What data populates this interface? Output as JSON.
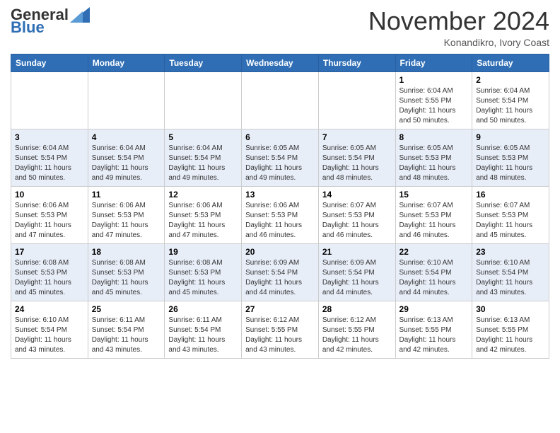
{
  "header": {
    "logo_general": "General",
    "logo_blue": "Blue",
    "month_title": "November 2024",
    "location": "Konandikro, Ivory Coast"
  },
  "weekdays": [
    "Sunday",
    "Monday",
    "Tuesday",
    "Wednesday",
    "Thursday",
    "Friday",
    "Saturday"
  ],
  "weeks": [
    [
      {
        "day": "",
        "sunrise": "",
        "sunset": "",
        "daylight": ""
      },
      {
        "day": "",
        "sunrise": "",
        "sunset": "",
        "daylight": ""
      },
      {
        "day": "",
        "sunrise": "",
        "sunset": "",
        "daylight": ""
      },
      {
        "day": "",
        "sunrise": "",
        "sunset": "",
        "daylight": ""
      },
      {
        "day": "",
        "sunrise": "",
        "sunset": "",
        "daylight": ""
      },
      {
        "day": "1",
        "sunrise": "Sunrise: 6:04 AM",
        "sunset": "Sunset: 5:55 PM",
        "daylight": "Daylight: 11 hours and 50 minutes."
      },
      {
        "day": "2",
        "sunrise": "Sunrise: 6:04 AM",
        "sunset": "Sunset: 5:54 PM",
        "daylight": "Daylight: 11 hours and 50 minutes."
      }
    ],
    [
      {
        "day": "3",
        "sunrise": "Sunrise: 6:04 AM",
        "sunset": "Sunset: 5:54 PM",
        "daylight": "Daylight: 11 hours and 50 minutes."
      },
      {
        "day": "4",
        "sunrise": "Sunrise: 6:04 AM",
        "sunset": "Sunset: 5:54 PM",
        "daylight": "Daylight: 11 hours and 49 minutes."
      },
      {
        "day": "5",
        "sunrise": "Sunrise: 6:04 AM",
        "sunset": "Sunset: 5:54 PM",
        "daylight": "Daylight: 11 hours and 49 minutes."
      },
      {
        "day": "6",
        "sunrise": "Sunrise: 6:05 AM",
        "sunset": "Sunset: 5:54 PM",
        "daylight": "Daylight: 11 hours and 49 minutes."
      },
      {
        "day": "7",
        "sunrise": "Sunrise: 6:05 AM",
        "sunset": "Sunset: 5:54 PM",
        "daylight": "Daylight: 11 hours and 48 minutes."
      },
      {
        "day": "8",
        "sunrise": "Sunrise: 6:05 AM",
        "sunset": "Sunset: 5:53 PM",
        "daylight": "Daylight: 11 hours and 48 minutes."
      },
      {
        "day": "9",
        "sunrise": "Sunrise: 6:05 AM",
        "sunset": "Sunset: 5:53 PM",
        "daylight": "Daylight: 11 hours and 48 minutes."
      }
    ],
    [
      {
        "day": "10",
        "sunrise": "Sunrise: 6:06 AM",
        "sunset": "Sunset: 5:53 PM",
        "daylight": "Daylight: 11 hours and 47 minutes."
      },
      {
        "day": "11",
        "sunrise": "Sunrise: 6:06 AM",
        "sunset": "Sunset: 5:53 PM",
        "daylight": "Daylight: 11 hours and 47 minutes."
      },
      {
        "day": "12",
        "sunrise": "Sunrise: 6:06 AM",
        "sunset": "Sunset: 5:53 PM",
        "daylight": "Daylight: 11 hours and 47 minutes."
      },
      {
        "day": "13",
        "sunrise": "Sunrise: 6:06 AM",
        "sunset": "Sunset: 5:53 PM",
        "daylight": "Daylight: 11 hours and 46 minutes."
      },
      {
        "day": "14",
        "sunrise": "Sunrise: 6:07 AM",
        "sunset": "Sunset: 5:53 PM",
        "daylight": "Daylight: 11 hours and 46 minutes."
      },
      {
        "day": "15",
        "sunrise": "Sunrise: 6:07 AM",
        "sunset": "Sunset: 5:53 PM",
        "daylight": "Daylight: 11 hours and 46 minutes."
      },
      {
        "day": "16",
        "sunrise": "Sunrise: 6:07 AM",
        "sunset": "Sunset: 5:53 PM",
        "daylight": "Daylight: 11 hours and 45 minutes."
      }
    ],
    [
      {
        "day": "17",
        "sunrise": "Sunrise: 6:08 AM",
        "sunset": "Sunset: 5:53 PM",
        "daylight": "Daylight: 11 hours and 45 minutes."
      },
      {
        "day": "18",
        "sunrise": "Sunrise: 6:08 AM",
        "sunset": "Sunset: 5:53 PM",
        "daylight": "Daylight: 11 hours and 45 minutes."
      },
      {
        "day": "19",
        "sunrise": "Sunrise: 6:08 AM",
        "sunset": "Sunset: 5:53 PM",
        "daylight": "Daylight: 11 hours and 45 minutes."
      },
      {
        "day": "20",
        "sunrise": "Sunrise: 6:09 AM",
        "sunset": "Sunset: 5:54 PM",
        "daylight": "Daylight: 11 hours and 44 minutes."
      },
      {
        "day": "21",
        "sunrise": "Sunrise: 6:09 AM",
        "sunset": "Sunset: 5:54 PM",
        "daylight": "Daylight: 11 hours and 44 minutes."
      },
      {
        "day": "22",
        "sunrise": "Sunrise: 6:10 AM",
        "sunset": "Sunset: 5:54 PM",
        "daylight": "Daylight: 11 hours and 44 minutes."
      },
      {
        "day": "23",
        "sunrise": "Sunrise: 6:10 AM",
        "sunset": "Sunset: 5:54 PM",
        "daylight": "Daylight: 11 hours and 43 minutes."
      }
    ],
    [
      {
        "day": "24",
        "sunrise": "Sunrise: 6:10 AM",
        "sunset": "Sunset: 5:54 PM",
        "daylight": "Daylight: 11 hours and 43 minutes."
      },
      {
        "day": "25",
        "sunrise": "Sunrise: 6:11 AM",
        "sunset": "Sunset: 5:54 PM",
        "daylight": "Daylight: 11 hours and 43 minutes."
      },
      {
        "day": "26",
        "sunrise": "Sunrise: 6:11 AM",
        "sunset": "Sunset: 5:54 PM",
        "daylight": "Daylight: 11 hours and 43 minutes."
      },
      {
        "day": "27",
        "sunrise": "Sunrise: 6:12 AM",
        "sunset": "Sunset: 5:55 PM",
        "daylight": "Daylight: 11 hours and 43 minutes."
      },
      {
        "day": "28",
        "sunrise": "Sunrise: 6:12 AM",
        "sunset": "Sunset: 5:55 PM",
        "daylight": "Daylight: 11 hours and 42 minutes."
      },
      {
        "day": "29",
        "sunrise": "Sunrise: 6:13 AM",
        "sunset": "Sunset: 5:55 PM",
        "daylight": "Daylight: 11 hours and 42 minutes."
      },
      {
        "day": "30",
        "sunrise": "Sunrise: 6:13 AM",
        "sunset": "Sunset: 5:55 PM",
        "daylight": "Daylight: 11 hours and 42 minutes."
      }
    ]
  ]
}
